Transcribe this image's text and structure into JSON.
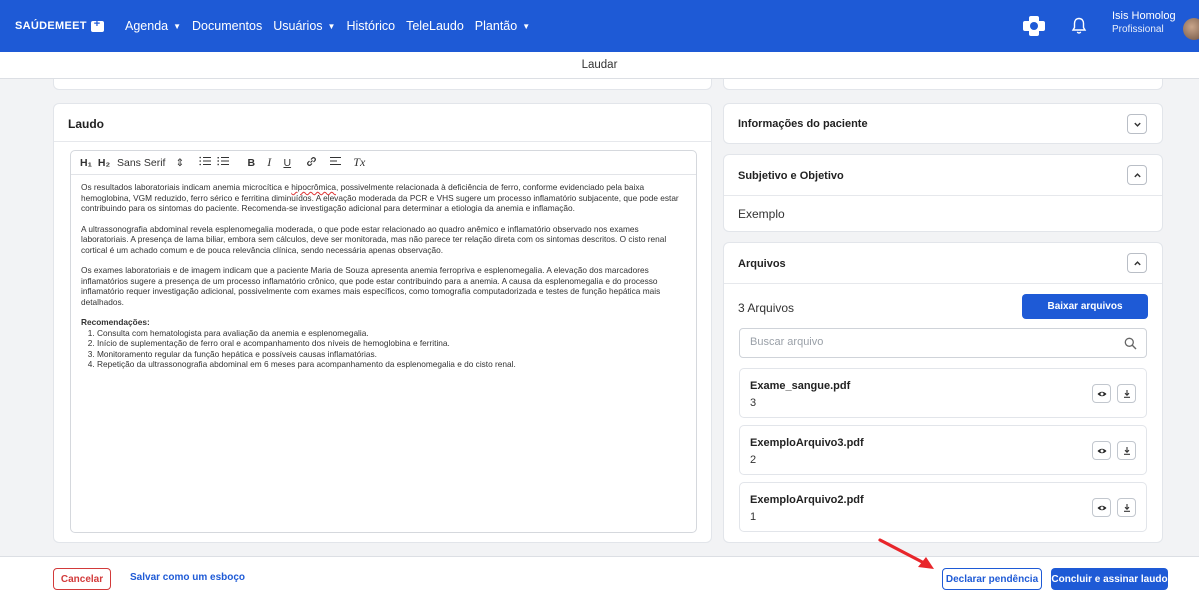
{
  "brand": {
    "logo": "SAÚDEMEET"
  },
  "nav": [
    {
      "label": "Agenda",
      "has_caret": true
    },
    {
      "label": "Documentos",
      "has_caret": false
    },
    {
      "label": "Usuários",
      "has_caret": true
    },
    {
      "label": "Histórico",
      "has_caret": false
    },
    {
      "label": "TeleLaudo",
      "has_caret": false
    },
    {
      "label": "Plantão",
      "has_caret": true
    }
  ],
  "user": {
    "name": "Isis Homolog",
    "role": "Profissional"
  },
  "page_title": "Laudar",
  "laudo": {
    "title": "Laudo",
    "toolbar": {
      "h1": "H₁",
      "h2": "H₂",
      "font": "Sans Serif",
      "font_caret": "⇕",
      "bold": "B",
      "italic": "I",
      "underline": "U",
      "link": "🔗︎",
      "clear": "Tx"
    },
    "paragraphs": [
      {
        "pre": "Os resultados laboratoriais indicam anemia microcítica e ",
        "flag": "hipocrômica",
        "post": ", possivelmente relacionada à deficiência de ferro, conforme evidenciado pela baixa hemoglobina, VGM reduzido, ferro sérico e ferritina diminuídos. A elevação moderada da PCR e VHS sugere um processo inflamatório subjacente, que pode estar contribuindo para os sintomas do paciente. Recomenda-se investigação adicional para determinar a etiologia da anemia e inflamação."
      },
      {
        "pre": "A ultrassonografia abdominal revela esplenomegalia moderada, o que pode estar relacionado ao quadro anêmico e inflamatório observado nos exames laboratoriais. A presença de lama biliar, embora sem cálculos, deve ser monitorada, mas não parece ter relação direta com os sintomas descritos. O cisto renal cortical é um achado comum e de pouca relevância clínica, sendo necessária apenas observação.",
        "flag": "",
        "post": ""
      },
      {
        "pre": "Os exames laboratoriais e de imagem indicam que a paciente Maria de Souza apresenta anemia ferropriva e esplenomegalia. A elevação dos marcadores inflamatórios sugere a presença de um processo inflamatório crônico, que pode estar contribuindo para a anemia. A causa da esplenomegalia e do processo inflamatório requer investigação adicional, possivelmente com exames mais específicos, como tomografia computadorizada e testes de função hepática mais detalhados.",
        "flag": "",
        "post": ""
      }
    ],
    "recommendations_title": "Recomendações:",
    "recommendations": [
      "Consulta com hematologista para avaliação da anemia e esplenomegalia.",
      "Início de suplementação de ferro oral e acompanhamento dos níveis de hemoglobina e ferritina.",
      "Monitoramento regular da função hepática e possíveis causas inflamatórias.",
      "Repetição da ultrassonografia abdominal em 6 meses para acompanhamento da esplenomegalia e do cisto renal."
    ]
  },
  "patient_info": {
    "title": "Informações do paciente"
  },
  "subjective": {
    "title": "Subjetivo e Objetivo",
    "content": "Exemplo"
  },
  "files": {
    "title": "Arquivos",
    "count_label": "3 Arquivos",
    "download_label": "Baixar arquivos",
    "search_placeholder": "Buscar arquivo",
    "items": [
      {
        "name": "Exame_sangue.pdf",
        "number": "3"
      },
      {
        "name": "ExemploArquivo3.pdf",
        "number": "2"
      },
      {
        "name": "ExemploArquivo2.pdf",
        "number": "1"
      }
    ]
  },
  "footer": {
    "cancel": "Cancelar",
    "draft": "Salvar como um esboço",
    "pending": "Declarar pendência",
    "sign": "Concluir e assinar laudo"
  },
  "colors": {
    "primary": "#1e5ad6",
    "danger": "#d23a3a",
    "annotation_arrow": "#e8262b"
  }
}
